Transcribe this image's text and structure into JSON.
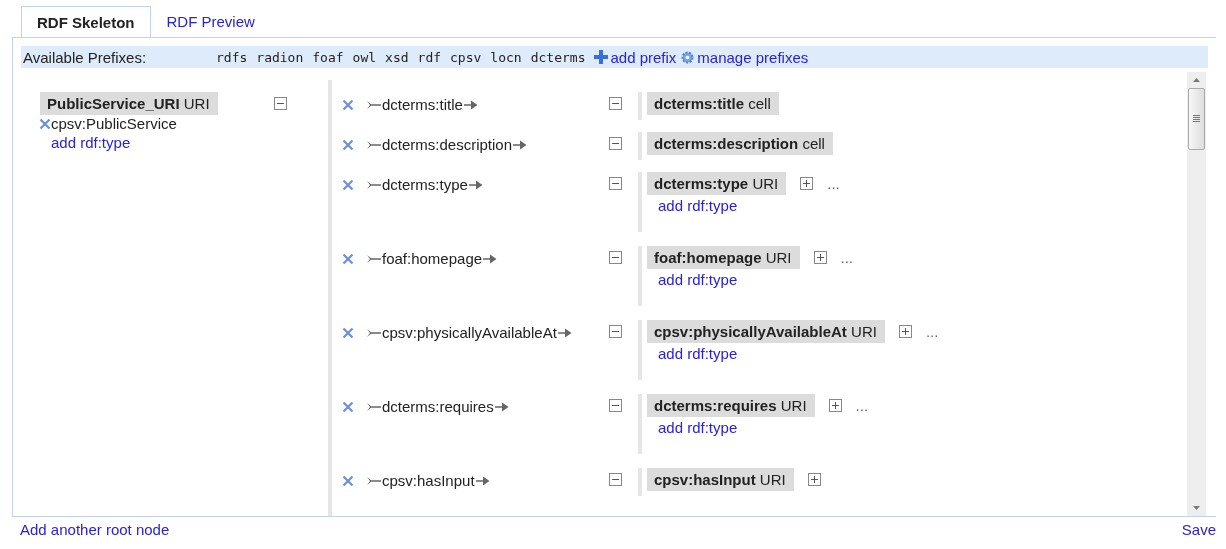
{
  "tabs": [
    {
      "label": "RDF Skeleton",
      "selected": true
    },
    {
      "label": "RDF Preview",
      "selected": false
    }
  ],
  "prefix_bar": {
    "label": "Available Prefixes:",
    "prefixes": [
      "rdfs",
      "radion",
      "foaf",
      "owl",
      "xsd",
      "rdf",
      "cpsv",
      "locn",
      "dcterms"
    ],
    "add_prefix": "add prefix",
    "manage_prefixes": "manage prefixes"
  },
  "root_node": {
    "name": "PublicService_URI",
    "type": "URI",
    "rdf_types": [
      "cpsv:PublicService"
    ],
    "add_type": "add rdf:type",
    "expanded": true
  },
  "properties": [
    {
      "name": "dcterms:title",
      "expanded": true,
      "object": {
        "name": "dcterms:title",
        "type": "cell",
        "kind": "cell"
      }
    },
    {
      "name": "dcterms:description",
      "expanded": true,
      "object": {
        "name": "dcterms:description",
        "type": "cell",
        "kind": "cell"
      }
    },
    {
      "name": "dcterms:type",
      "expanded": true,
      "object": {
        "name": "dcterms:type",
        "type": "URI",
        "kind": "uri",
        "more": "...",
        "add_type": "add rdf:type"
      }
    },
    {
      "name": "foaf:homepage",
      "expanded": true,
      "object": {
        "name": "foaf:homepage",
        "type": "URI",
        "kind": "uri",
        "more": "...",
        "add_type": "add rdf:type"
      }
    },
    {
      "name": "cpsv:physicallyAvailableAt",
      "expanded": true,
      "object": {
        "name": "cpsv:physicallyAvailableAt",
        "type": "URI",
        "kind": "uri",
        "more": "...",
        "add_type": "add rdf:type"
      }
    },
    {
      "name": "dcterms:requires",
      "expanded": true,
      "object": {
        "name": "dcterms:requires",
        "type": "URI",
        "kind": "uri",
        "more": "...",
        "add_type": "add rdf:type"
      }
    },
    {
      "name": "cpsv:hasInput",
      "expanded": true,
      "object": {
        "name": "cpsv:hasInput",
        "type": "URI",
        "kind": "uri"
      }
    }
  ],
  "footer": {
    "add_root": "Add another root node",
    "save": "Save"
  }
}
